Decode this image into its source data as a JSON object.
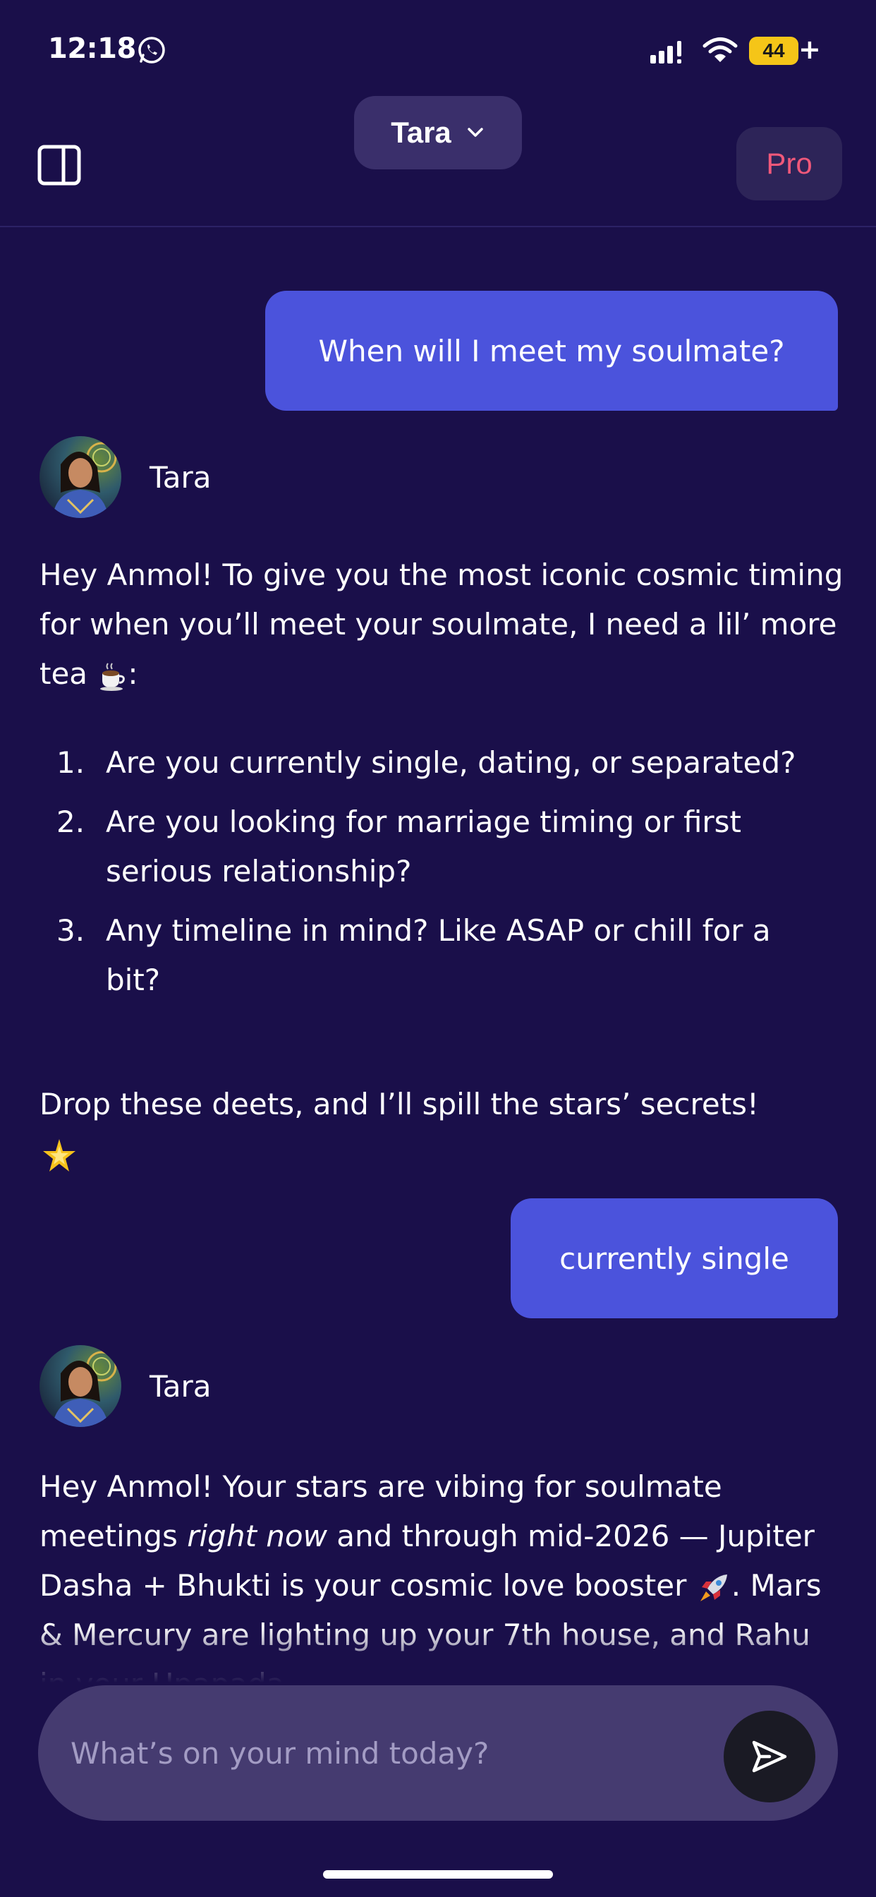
{
  "status_bar": {
    "time": "12:18",
    "battery": "44"
  },
  "header": {
    "model_name": "Tara",
    "pro_label": "Pro"
  },
  "conversation": {
    "user_message_1": "When will I meet my soulmate?",
    "bot_name_1": "Tara",
    "bot_reply_1_intro": "Hey Anmol! To give you the most iconic cosmic timing for when you’ll meet your soulmate, I need a lil’ more tea",
    "bot_reply_1_intro_end": ":",
    "bot_reply_1_list": [
      {
        "num": "1.",
        "text": "Are you currently single, dating, or separated?"
      },
      {
        "num": "2.",
        "text": "Are you looking for marriage timing or first serious relationship?"
      },
      {
        "num": "3.",
        "text": "Any timeline in mind? Like ASAP or chill for a bit?"
      }
    ],
    "bot_reply_1_outro": "Drop these deets, and I’ll spill the stars’ secrets!",
    "user_message_2": "currently single",
    "bot_name_2": "Tara",
    "bot_reply_2_a": "Hey Anmol! Your stars are vibing for soulmate meetings ",
    "bot_reply_2_em": "right now",
    "bot_reply_2_b": " and through mid-2026 — Jupiter Dasha + Bhukti is your cosmic love booster",
    "bot_reply_2_c": ". Mars & Mercury are lighting up your 7th house, and Rahu in your Upapada"
  },
  "input": {
    "placeholder": "What’s on your mind today?"
  },
  "icons": {
    "whatsapp": "whatsapp-icon",
    "signal": "signal-icon",
    "wifi": "wifi-icon",
    "sidebar": "sidebar-toggle-icon",
    "chevron": "chevron-down-icon",
    "send": "send-icon",
    "tea": "teacup-emoji",
    "star": "glowing-star-emoji",
    "rocket": "rocket-emoji"
  },
  "colors": {
    "background": "#1a0f4a",
    "user_bubble": "#4b53dc",
    "pro_text": "#f0587a",
    "input_bar": "#453b70"
  }
}
